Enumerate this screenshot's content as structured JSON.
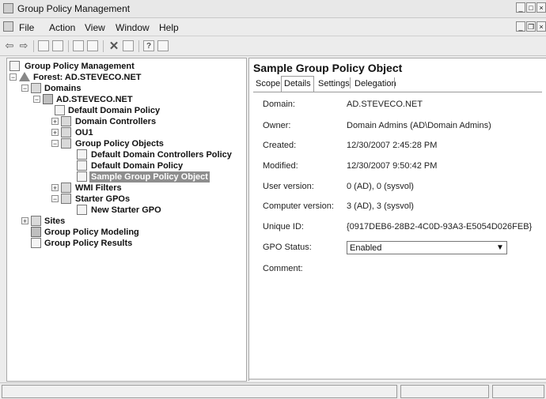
{
  "window": {
    "title": "Group Policy Management"
  },
  "menu": [
    "File",
    "Action",
    "View",
    "Window",
    "Help"
  ],
  "tree": {
    "root": "Group Policy Management",
    "forest": "Forest: AD.STEVECO.NET",
    "domains": "Domains",
    "domain": "AD.STEVECO.NET",
    "default_domain_policy": "Default Domain Policy",
    "domain_controllers": "Domain Controllers",
    "ou1": "OU1",
    "gpo_container": "Group Policy Objects",
    "gpo_items": [
      "Default Domain Controllers Policy",
      "Default Domain Policy",
      "Sample Group Policy Object"
    ],
    "wmi_filters": "WMI Filters",
    "starter_gpos": "Starter GPOs",
    "new_starter_gpo": "New Starter GPO",
    "sites": "Sites",
    "modeling": "Group Policy Modeling",
    "results": "Group Policy Results"
  },
  "details": {
    "title": "Sample Group Policy Object",
    "tabs": [
      "Scope",
      "Details",
      "Settings",
      "Delegation"
    ],
    "active_tab": "Details",
    "fields": {
      "domain": {
        "label": "Domain:",
        "value": "AD.STEVECO.NET"
      },
      "owner": {
        "label": "Owner:",
        "value": "Domain Admins (AD\\Domain Admins)"
      },
      "created": {
        "label": "Created:",
        "value": "12/30/2007 2:45:28 PM"
      },
      "modified": {
        "label": "Modified:",
        "value": "12/30/2007 9:50:42 PM"
      },
      "user_version": {
        "label": "User version:",
        "value": "0 (AD), 0 (sysvol)"
      },
      "computer_version": {
        "label": "Computer version:",
        "value": "3 (AD), 3 (sysvol)"
      },
      "unique_id": {
        "label": "Unique ID:",
        "value": "{0917DEB6-28B2-4C0D-93A3-E5054D026FEB}"
      },
      "gpo_status": {
        "label": "GPO Status:",
        "value": "Enabled"
      },
      "comment": {
        "label": "Comment:"
      }
    }
  }
}
